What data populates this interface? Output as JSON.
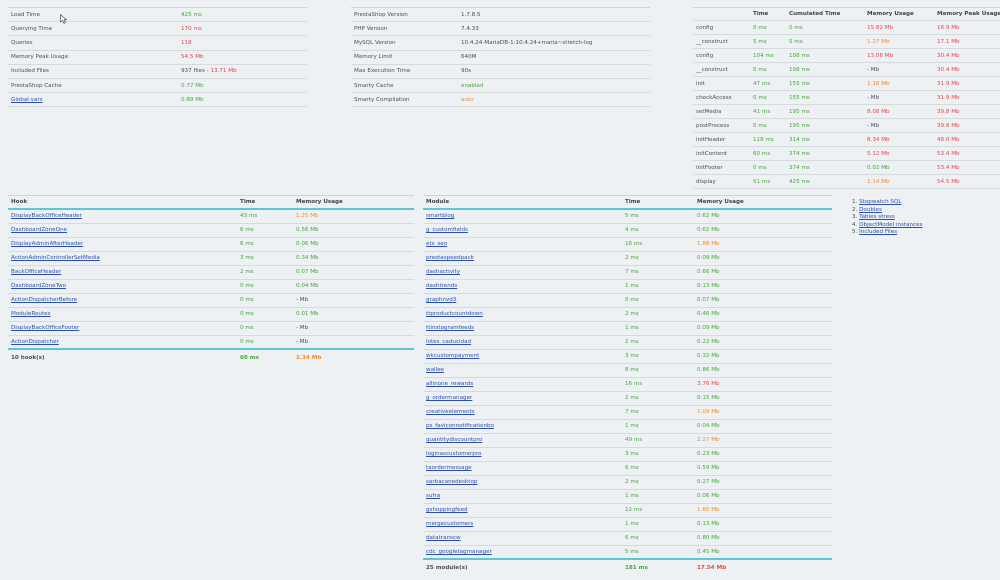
{
  "summary": {
    "rows": [
      {
        "label": "Load Time",
        "value": "425 ms",
        "cls": "ok"
      },
      {
        "label": "Querying Time",
        "value": "170 ms",
        "cls": "bad"
      },
      {
        "label": "Queries",
        "value": "118",
        "cls": "bad"
      },
      {
        "label": "Memory Peak Usage",
        "value": "54.5 Mb",
        "cls": "bad"
      },
      {
        "label": "Included Files",
        "value": "937 files - ",
        "extra": "13.71 Mb",
        "cls": "muted"
      },
      {
        "label": "PrestaShop Cache",
        "value": "0.77 Mb",
        "cls": "ok"
      },
      {
        "label": "Global vars",
        "value": "0.89 Mb",
        "cls": "ok",
        "link": true
      }
    ]
  },
  "config": {
    "rows": [
      {
        "label": "PrestaShop Version",
        "value": "1.7.8.5",
        "cls": "muted"
      },
      {
        "label": "PHP Version",
        "value": "7.4.33",
        "cls": "muted"
      },
      {
        "label": "MySQL Version",
        "value": "10.4.24-MariaDB-1:10.4.24+maria~stretch-log",
        "cls": "muted"
      },
      {
        "label": "Memory Limit",
        "value": "640M",
        "cls": "muted"
      },
      {
        "label": "Max Execution Time",
        "value": "90s",
        "cls": "muted"
      },
      {
        "label": "Smarty Cache",
        "value": "enabled",
        "cls": "ok"
      },
      {
        "label": "Smarty Compilation",
        "value": "auto",
        "cls": "warn"
      }
    ]
  },
  "stopwatch": {
    "headers": [
      "",
      "Time",
      "Cumulated Time",
      "Memory Usage",
      "Memory Peak Usage"
    ],
    "rows": [
      [
        "config",
        "0 ms",
        "ok",
        "0 ms",
        "ok",
        "15.82 Mb",
        "bad",
        "16.9 Mb",
        "bad"
      ],
      [
        "__construct",
        "5 ms",
        "ok",
        "5 ms",
        "ok",
        "1.27 Mb",
        "warn",
        "17.1 Mb",
        "bad"
      ],
      [
        "config",
        "104 ms",
        "ok",
        "108 ms",
        "ok",
        "13.06 Mb",
        "bad",
        "30.4 Mb",
        "bad"
      ],
      [
        "__construct",
        "0 ms",
        "ok",
        "108 ms",
        "ok",
        "- Mb",
        "muted",
        "30.4 Mb",
        "bad"
      ],
      [
        "init",
        "47 ms",
        "ok",
        "155 ms",
        "ok",
        "1.16 Mb",
        "warn",
        "31.9 Mb",
        "bad"
      ],
      [
        "checkAccess",
        "0 ms",
        "ok",
        "155 ms",
        "ok",
        "- Mb",
        "muted",
        "31.9 Mb",
        "bad"
      ],
      [
        "setMedia",
        "41 ms",
        "ok",
        "195 ms",
        "ok",
        "8.08 Mb",
        "bad",
        "39.8 Mb",
        "bad"
      ],
      [
        "postProcess",
        "0 ms",
        "ok",
        "195 ms",
        "ok",
        "- Mb",
        "muted",
        "39.8 Mb",
        "bad"
      ],
      [
        "initHeader",
        "118 ms",
        "ok",
        "314 ms",
        "ok",
        "8.34 Mb",
        "bad",
        "48.0 Mb",
        "bad"
      ],
      [
        "initContent",
        "60 ms",
        "ok",
        "374 ms",
        "ok",
        "5.12 Mb",
        "bad",
        "53.4 Mb",
        "bad"
      ],
      [
        "initFooter",
        "0 ms",
        "ok",
        "374 ms",
        "ok",
        "0.02 Mb",
        "ok",
        "53.4 Mb",
        "bad"
      ],
      [
        "display",
        "51 ms",
        "ok",
        "425 ms",
        "ok",
        "1.14 Mb",
        "warn",
        "54.5 Mb",
        "bad"
      ]
    ]
  },
  "legend": [
    {
      "num": "1.",
      "label": "Stopwatch SQL"
    },
    {
      "num": "2.",
      "label": "Doubles"
    },
    {
      "num": "3.",
      "label": "Tables stress"
    },
    {
      "num": "4.",
      "label": "ObjectModel instances"
    },
    {
      "num": "5.",
      "label": "Included Files"
    }
  ],
  "hooks": {
    "headers": [
      "Hook",
      "Time",
      "Memory Usage"
    ],
    "rows": [
      [
        "DisplayBackOfficeHeader",
        "43 ms",
        "ok",
        "1.25 Mb",
        "warn"
      ],
      [
        "DashboardZoneOne",
        "6 ms",
        "ok",
        "0.56 Mb",
        "ok"
      ],
      [
        "DisplayAdminAfterHeader",
        "6 ms",
        "ok",
        "0.06 Mb",
        "ok"
      ],
      [
        "ActionAdminControllerSetMedia",
        "3 ms",
        "ok",
        "0.34 Mb",
        "ok"
      ],
      [
        "BackOfficeHeader",
        "2 ms",
        "ok",
        "0.07 Mb",
        "ok"
      ],
      [
        "DashboardZoneTwo",
        "0 ms",
        "ok",
        "0.04 Mb",
        "ok"
      ],
      [
        "ActionDispatcherBefore",
        "0 ms",
        "ok",
        "- Mb",
        "muted"
      ],
      [
        "ModuleRoutes",
        "0 ms",
        "ok",
        "0.01 Mb",
        "ok"
      ],
      [
        "DisplayBackOfficeFooter",
        "0 ms",
        "ok",
        "- Mb",
        "muted"
      ],
      [
        "ActionDispatcher",
        "0 ms",
        "ok",
        "- Mb",
        "muted"
      ]
    ],
    "footer": [
      "10 hook(s)",
      "60 ms",
      "ok",
      "2.34 Mb",
      "warn"
    ]
  },
  "modules": {
    "headers": [
      "Module",
      "Time",
      "Memory Usage"
    ],
    "rows": [
      [
        "smartblog",
        "5 ms",
        "ok",
        "0.62 Mb",
        "ok"
      ],
      [
        "g_customfields",
        "4 ms",
        "ok",
        "0.62 Mb",
        "ok"
      ],
      [
        "ets_seo",
        "16 ms",
        "ok",
        "1.88 Mb",
        "warn"
      ],
      [
        "prestaspeedpack",
        "2 ms",
        "ok",
        "0.09 Mb",
        "ok"
      ],
      [
        "dashactivity",
        "7 ms",
        "ok",
        "0.66 Mb",
        "ok"
      ],
      [
        "dashtrends",
        "1 ms",
        "ok",
        "0.13 Mb",
        "ok"
      ],
      [
        "graphnvd3",
        "0 ms",
        "ok",
        "0.07 Mb",
        "ok"
      ],
      [
        "ttproductcountdown",
        "2 ms",
        "ok",
        "0.46 Mb",
        "ok"
      ],
      [
        "ttinstagramfeeds",
        "1 ms",
        "ok",
        "0.09 Mb",
        "ok"
      ],
      [
        "lotes_caducidad",
        "2 ms",
        "ok",
        "0.22 Mb",
        "ok"
      ],
      [
        "wkcustompayment",
        "3 ms",
        "ok",
        "0.32 Mb",
        "ok"
      ],
      [
        "wallee",
        "8 ms",
        "ok",
        "0.86 Mb",
        "ok"
      ],
      [
        "allinone_rewards",
        "16 ms",
        "ok",
        "3.76 Mb",
        "bad"
      ],
      [
        "g_ordermanager",
        "2 ms",
        "ok",
        "0.15 Mb",
        "ok"
      ],
      [
        "creativeelements",
        "7 ms",
        "ok",
        "1.09 Mb",
        "warn"
      ],
      [
        "ps_faviconnotificationbo",
        "1 ms",
        "ok",
        "0.04 Mb",
        "ok"
      ],
      [
        "quantitydiscountpro",
        "49 ms",
        "ok",
        "2.27 Mb",
        "warn"
      ],
      [
        "loginascustomerpro",
        "3 ms",
        "ok",
        "0.23 Mb",
        "ok"
      ],
      [
        "taordermessage",
        "6 ms",
        "ok",
        "0.59 Mb",
        "ok"
      ],
      [
        "sarbacanedesktop",
        "2 ms",
        "ok",
        "0.27 Mb",
        "ok"
      ],
      [
        "sufra",
        "1 ms",
        "ok",
        "0.06 Mb",
        "ok"
      ],
      [
        "gshoppingfeed",
        "12 ms",
        "ok",
        "1.60 Mb",
        "warn"
      ],
      [
        "mergecustomers",
        "1 ms",
        "ok",
        "0.13 Mb",
        "ok"
      ],
      [
        "datatranscw",
        "6 ms",
        "ok",
        "0.80 Mb",
        "ok"
      ],
      [
        "cdc_googletagmanager",
        "5 ms",
        "ok",
        "0.45 Mb",
        "ok"
      ]
    ],
    "footer": [
      "25 module(s)",
      "181 ms",
      "ok",
      "17.54 Mb",
      "bad"
    ]
  }
}
